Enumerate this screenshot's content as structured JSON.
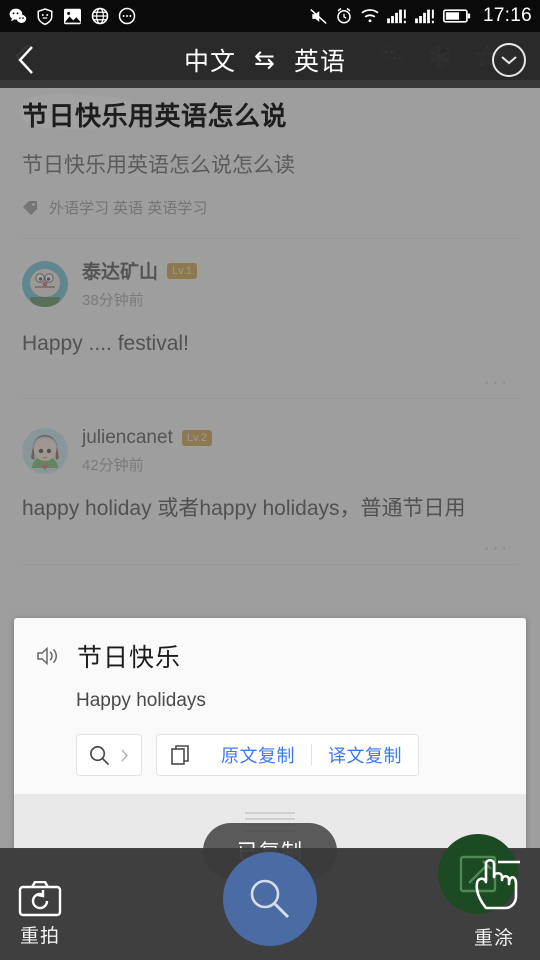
{
  "status_bar": {
    "time": "17:16",
    "left_icons": [
      "wechat-icon",
      "shield-icon",
      "image-icon",
      "globe-icon",
      "more-circle-icon"
    ],
    "right_icons": [
      "mute-icon",
      "alarm-icon",
      "wifi-icon",
      "signal-1-icon",
      "signal-2-icon",
      "battery-icon"
    ]
  },
  "translate_header": {
    "source_lang": "中文",
    "swap_symbol": "⇆",
    "target_lang": "英语",
    "back_icon": "back-chevron-icon",
    "expand_icon": "chevron-down-icon"
  },
  "underlying_page": {
    "appbar_icons": [
      "wechat-icon",
      "camera-aperture-icon",
      "star-icon",
      "overflow-menu-icon"
    ],
    "title": "节日快乐用英语怎么说",
    "highlight_text": "节日快乐",
    "subtitle": "节日快乐用英语怎么说怎么读",
    "tags_icon": "tag-icon",
    "tags": "外语学习 英语 英语学习",
    "posts": [
      {
        "avatar": "cartoon-avatar-1",
        "name": "泰达矿山",
        "level": "Lv.1",
        "time": "38分钟前",
        "body": "Happy .... festival!",
        "more": "···"
      },
      {
        "avatar": "cartoon-avatar-2",
        "name": "juliencanet",
        "level": "Lv.2",
        "time": "42分钟前",
        "body": "happy holiday 或者happy holidays，普通节日用",
        "more": "···"
      }
    ]
  },
  "result_card": {
    "speaker_icon": "speaker-icon",
    "source_text": "节日快乐",
    "translated_text": "Happy holidays",
    "search_icon": "search-icon",
    "search_chevron": "chevron-right-icon",
    "copy_icon": "copy-icon",
    "copy_source_label": "原文复制",
    "copy_translation_label": "译文复制",
    "drag_handle": "drag-handle-icon"
  },
  "toast": {
    "message": "已复制"
  },
  "bottom_bar": {
    "retake_icon": "camera-retake-icon",
    "retake_label": "重拍",
    "search_fab_icon": "search-icon",
    "repaint_icon": "edit-square-icon",
    "repaint_label": "重涂",
    "cursor": "hand-cursor-icon"
  },
  "colors": {
    "accent_blue": "#3b7af0",
    "fab_blue": "#4a6ba4",
    "fab_green": "#1c4a22",
    "level_badge": "#c8922b",
    "dim": "#808080"
  }
}
